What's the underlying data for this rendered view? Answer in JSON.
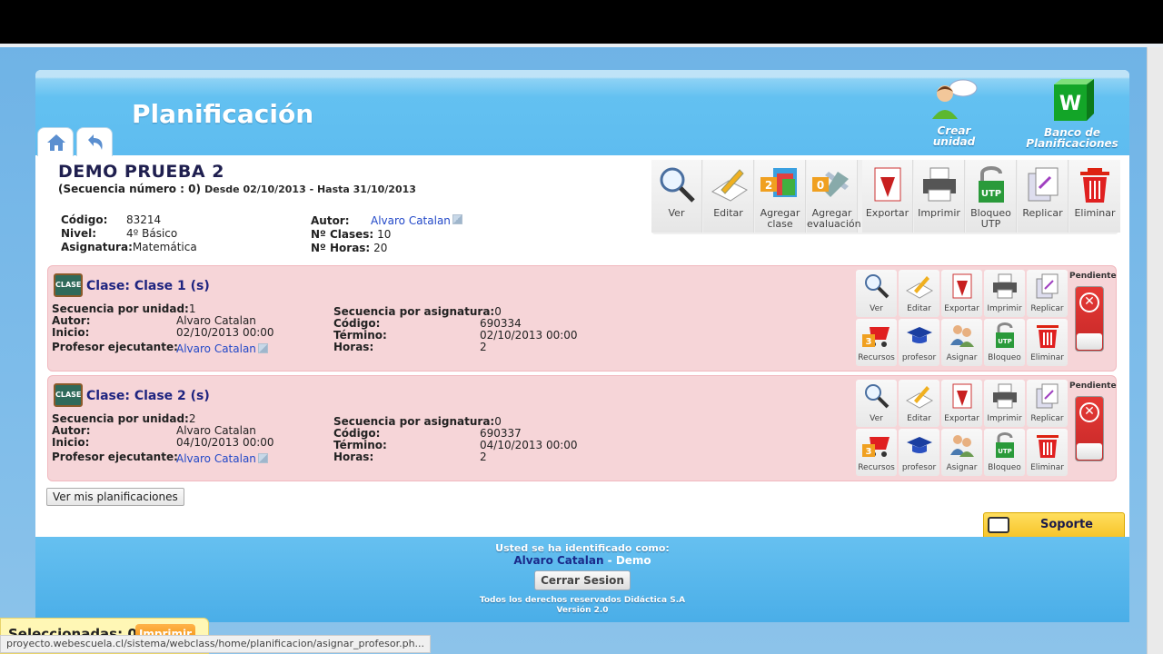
{
  "header": {
    "title": "Planificación",
    "crear_unidad": "Crear unidad",
    "crear_bubble": "Crear Unidad",
    "banco": "Banco de Planificaciones"
  },
  "plan": {
    "title": "DEMO PRUEBA 2",
    "secuencia": "(Secuencia número : 0)",
    "dates": "Desde 02/10/2013 - Hasta 31/10/2013",
    "codigo_label": "Código:",
    "codigo": "83214",
    "nivel_label": "Nivel:",
    "nivel": "4º Básico",
    "asignatura_label": "Asignatura:",
    "asignatura": "Matemática",
    "autor_label": "Autor:",
    "autor": "Alvaro Catalan",
    "clases_label": "Nº Clases:",
    "clases": "10",
    "horas_label": "Nº Horas:",
    "horas": "20"
  },
  "toolbar": [
    {
      "label": "Ver",
      "icon": "magnifier-icon"
    },
    {
      "label": "Editar",
      "icon": "edit-icon"
    },
    {
      "label": "Agregar clase",
      "icon": "add-class-icon",
      "badge": "2"
    },
    {
      "label": "Agregar evaluación",
      "icon": "add-evaluation-icon",
      "badge": "0"
    },
    {
      "label": "Exportar",
      "icon": "pdf-export-icon"
    },
    {
      "label": "Imprimir",
      "icon": "printer-icon"
    },
    {
      "label": "Bloqueo UTP",
      "icon": "lock-utp-icon"
    },
    {
      "label": "Replicar",
      "icon": "replicate-icon"
    },
    {
      "label": "Eliminar",
      "icon": "trash-icon"
    }
  ],
  "clases": [
    {
      "title": "Clase: Clase 1 (s)",
      "icon_text": "CLASE",
      "seq_unidad_label": "Secuencia por unidad:",
      "seq_unidad": "1",
      "autor_label": "Autor:",
      "autor": "Alvaro Catalan",
      "inicio_label": "Inicio:",
      "inicio": "02/10/2013 00:00",
      "profesor_label": "Profesor ejecutante:",
      "profesor": "Alvaro Catalan",
      "seq_asig_label": "Secuencia por asignatura:",
      "seq_asig": "0",
      "codigo_label": "Código:",
      "codigo": "690334",
      "termino_label": "Término:",
      "termino": "02/10/2013 00:00",
      "horas_label": "Horas:",
      "horas": "2",
      "pendiente": "Pendiente",
      "badge": "3"
    },
    {
      "title": "Clase: Clase 2 (s)",
      "icon_text": "CLASE",
      "seq_unidad_label": "Secuencia por unidad:",
      "seq_unidad": "2",
      "autor_label": "Autor:",
      "autor": "Alvaro Catalan",
      "inicio_label": "Inicio:",
      "inicio": "04/10/2013 00:00",
      "profesor_label": "Profesor ejecutante:",
      "profesor": "Alvaro Catalan",
      "seq_asig_label": "Secuencia por asignatura:",
      "seq_asig": "0",
      "codigo_label": "Código:",
      "codigo": "690337",
      "termino_label": "Término:",
      "termino": "04/10/2013 00:00",
      "horas_label": "Horas:",
      "horas": "2",
      "pendiente": "Pendiente",
      "badge": "3"
    }
  ],
  "class_actions": {
    "row1": [
      "Ver",
      "Editar",
      "Exportar",
      "Imprimir",
      "Replicar"
    ],
    "row2": [
      "Recursos",
      "profesor",
      "Asignar",
      "Bloqueo",
      "Eliminar"
    ]
  },
  "ver_mis": "Ver mis planificaciones",
  "soporte": "Soporte",
  "footer": {
    "identificado": "Usted se ha identificado como:",
    "user": "Alvaro Catalan",
    "role": " - Demo",
    "cerrar": "Cerrar Sesion",
    "rights": "Todos los derechos reservados Didáctica S.A",
    "version": "Versión 2.0"
  },
  "selection": {
    "label": "Seleccionadas: 0",
    "imprimir": "Imprimir"
  },
  "status_url": "proyecto.webescuela.cl/sistema/webclass/home/planificacion/asignar_profesor.ph..."
}
